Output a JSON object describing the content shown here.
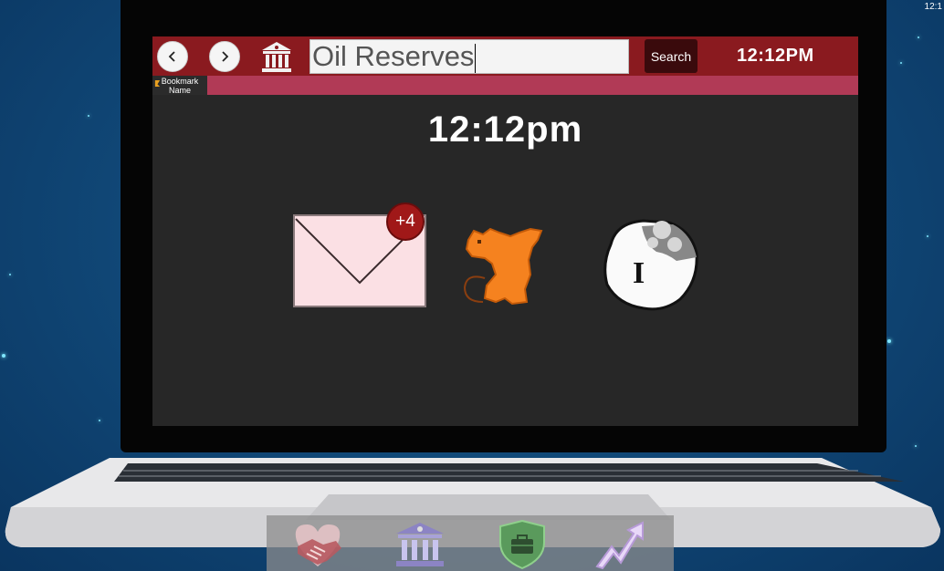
{
  "corner_time": "12:1",
  "browser": {
    "back_icon": "chevron-left-icon",
    "forward_icon": "chevron-right-icon",
    "site_icon": "bank-icon",
    "url_value": "Oil Reserves",
    "search_label": "Search",
    "clock": "12:12PM"
  },
  "bookmarks": [
    {
      "label_line1": "Bookmark",
      "label_line2": "Name",
      "icon": "bookmark-icon"
    }
  ],
  "desktop": {
    "clock": "12:12pm",
    "apps": [
      {
        "name": "mail",
        "icon": "envelope-icon",
        "badge": "+4"
      },
      {
        "name": "mouse",
        "icon": "orange-mouse-icon"
      },
      {
        "name": "info",
        "icon": "helmet-info-icon",
        "glyph": "I"
      }
    ]
  },
  "dock": {
    "items": [
      {
        "icon": "handshake-icon"
      },
      {
        "icon": "bank-icon"
      },
      {
        "icon": "briefcase-shield-icon"
      },
      {
        "icon": "trend-arrow-icon"
      }
    ]
  },
  "colors": {
    "toolbar": "#8a1a1f",
    "bookmark_bar": "#b13a56",
    "screen_bg": "#272727",
    "badge": "#a01818"
  }
}
